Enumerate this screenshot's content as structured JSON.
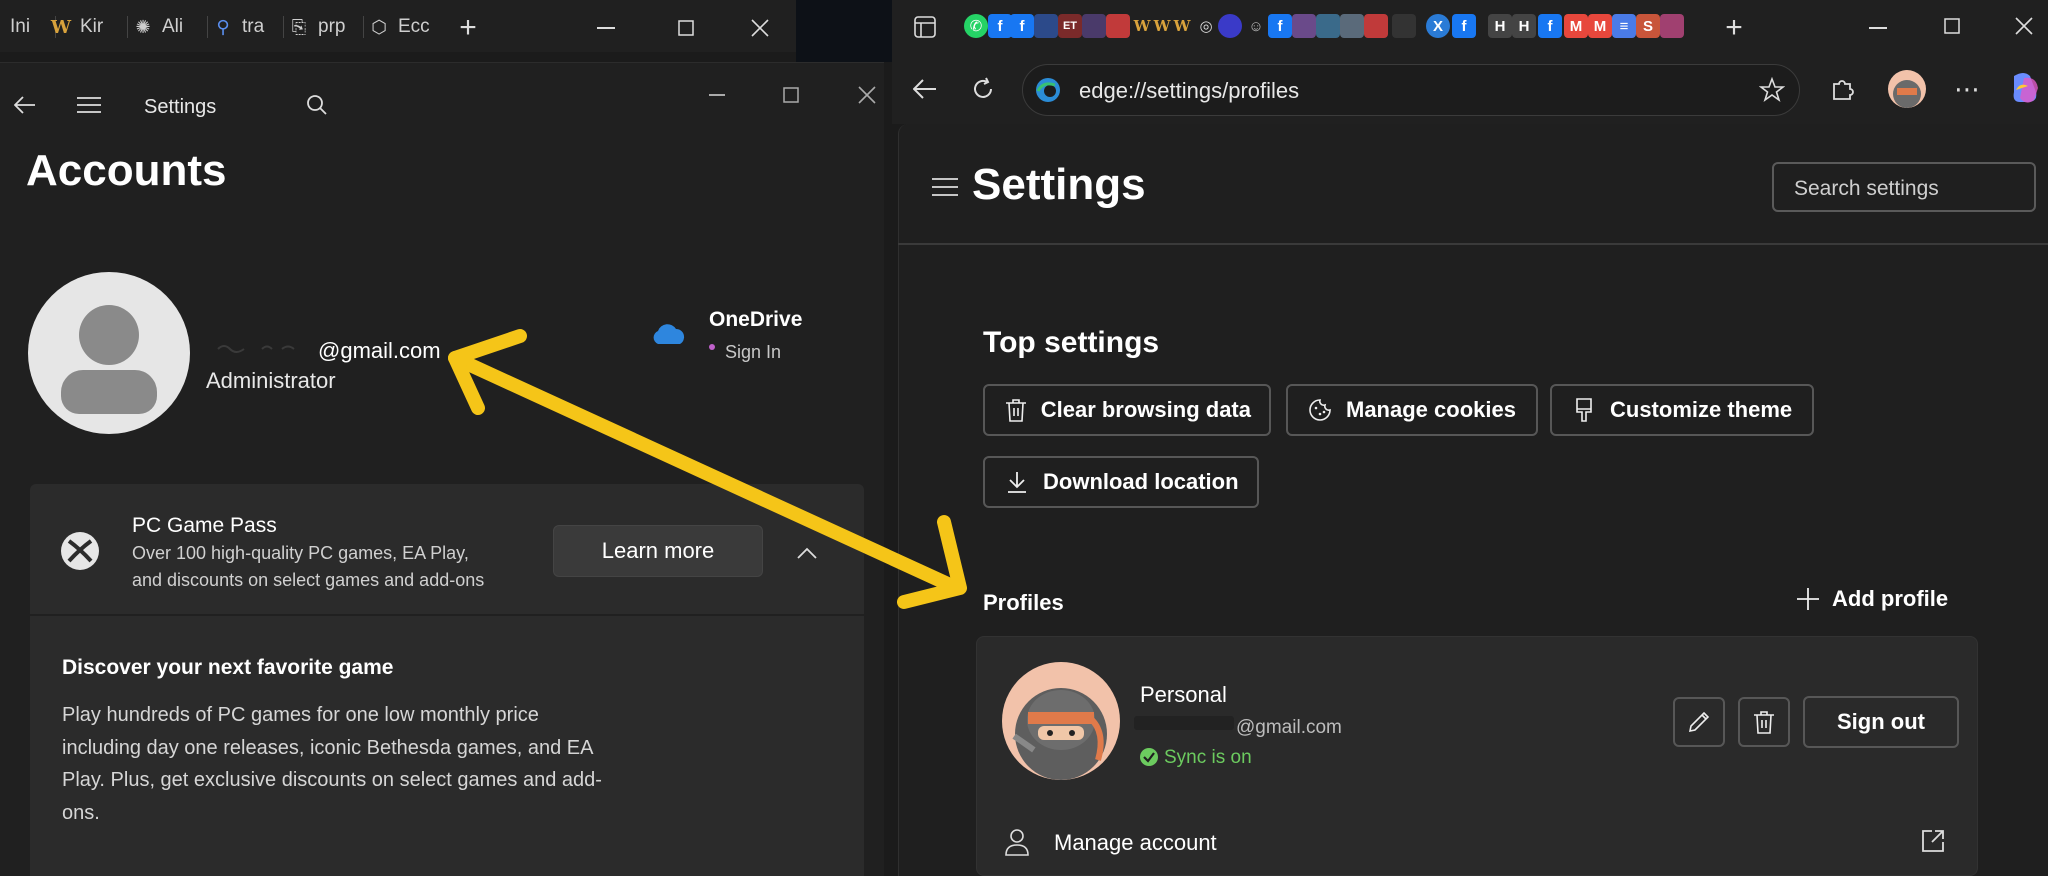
{
  "left_tabs": [
    {
      "label": "Ini",
      "icon": "page-icon"
    },
    {
      "label": "Kir",
      "icon": "w-logo-icon"
    },
    {
      "label": "Ali",
      "icon": "openai-icon"
    },
    {
      "label": "tra",
      "icon": "search-icon"
    },
    {
      "label": "prp",
      "icon": "blocked-page-icon"
    },
    {
      "label": "Ecc",
      "icon": "shield-icon"
    }
  ],
  "settings_app": {
    "header_title": "Settings",
    "page_title": "Accounts",
    "account": {
      "email": "@gmail.com",
      "role": "Administrator"
    },
    "onedrive": {
      "title": "OneDrive",
      "status": "Sign In"
    },
    "game_pass": {
      "title": "PC Game Pass",
      "desc_line1": "Over 100 high-quality PC games, EA Play,",
      "desc_line2": "and discounts on select games and add-ons",
      "learn_more": "Learn more"
    },
    "discover": {
      "title": "Discover your next favorite game",
      "line1": "Play hundreds of PC games for one low monthly price",
      "line2": "including day one releases, iconic Bethesda games, and EA",
      "line3": "Play. Plus, get exclusive discounts on select games and add-",
      "line4": "ons."
    }
  },
  "edge": {
    "url": "edge://settings/profiles",
    "page_title": "Settings",
    "search_placeholder": "Search settings",
    "top_settings_heading": "Top settings",
    "buttons": {
      "clear": "Clear browsing data",
      "cookies": "Manage cookies",
      "theme": "Customize theme",
      "download": "Download location"
    },
    "profiles_heading": "Profiles",
    "add_profile": "Add profile",
    "profile": {
      "name": "Personal",
      "email": "@gmail.com",
      "sync": "Sync is on",
      "sign_out": "Sign out",
      "manage_account": "Manage account"
    }
  },
  "colors": {
    "arrow": "#f5c518",
    "sync_green": "#6ccb5f",
    "onedrive_blue": "#2e86de",
    "signin_dot": "#c061cb"
  }
}
